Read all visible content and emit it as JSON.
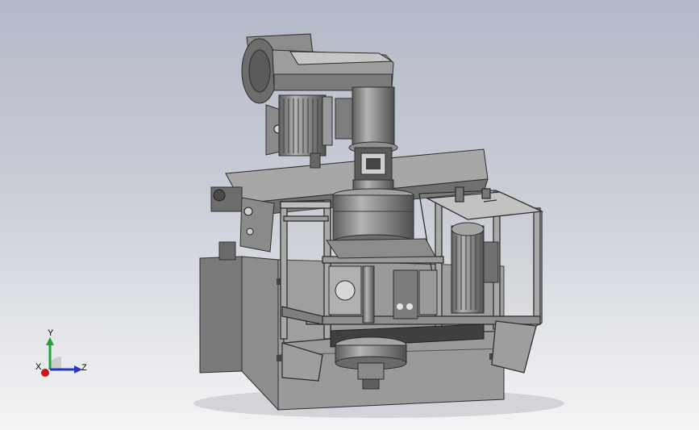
{
  "viewport": {
    "background_top": "#b3b9c7",
    "background_bottom": "#f4f4f5",
    "model_name": "",
    "model_icon": "machine-assembly-icon"
  },
  "triad": {
    "x_label": "X",
    "y_label": "Y",
    "z_label": "Z",
    "x_color": "#c8171b",
    "y_color": "#22a33a",
    "z_color": "#2437c4"
  }
}
